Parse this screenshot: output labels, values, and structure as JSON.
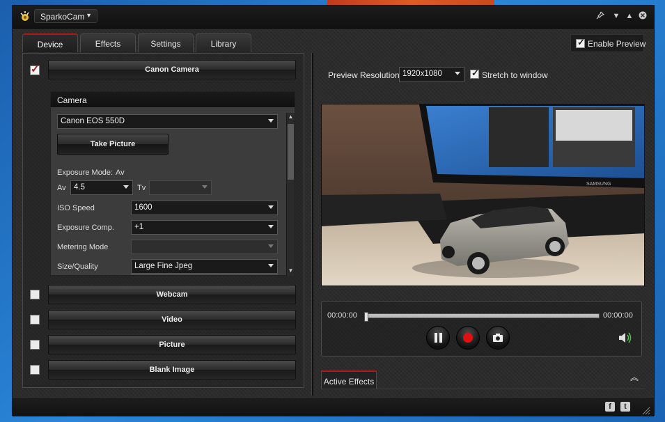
{
  "app": {
    "name": "SparkoCam"
  },
  "tabs": [
    {
      "label": "Device",
      "active": true
    },
    {
      "label": "Effects",
      "active": false
    },
    {
      "label": "Settings",
      "active": false
    },
    {
      "label": "Library",
      "active": false
    }
  ],
  "enable_preview": {
    "label": "Enable Preview",
    "checked": true
  },
  "devices": {
    "canon": {
      "label": "Canon Camera",
      "checked": true
    },
    "webcam": {
      "label": "Webcam",
      "checked": false
    },
    "video": {
      "label": "Video",
      "checked": false
    },
    "picture": {
      "label": "Picture",
      "checked": false
    },
    "blank": {
      "label": "Blank Image",
      "checked": false
    }
  },
  "camera": {
    "group_title": "Camera",
    "model": "Canon EOS 550D",
    "take_picture": "Take Picture",
    "exposure_mode_label": "Exposure Mode:",
    "exposure_mode_value": "Av",
    "av_label": "Av",
    "av_value": "4.5",
    "tv_label": "Tv",
    "tv_value": "",
    "iso_label": "ISO Speed",
    "iso_value": "1600",
    "exp_comp_label": "Exposure Comp.",
    "exp_comp_value": "+1",
    "metering_label": "Metering Mode",
    "metering_value": "",
    "size_label": "Size/Quality",
    "size_value": "Large Fine Jpeg"
  },
  "preview": {
    "resolution_label": "Preview Resolution:",
    "resolution_value": "1920x1080",
    "stretch_label": "Stretch to window",
    "stretch_checked": true,
    "monitor_brand": "SAMSUNG"
  },
  "playback": {
    "time_start": "00:00:00",
    "time_end": "00:00:00",
    "progress": 0
  },
  "active_effects": {
    "label": "Active Effects"
  },
  "colors": {
    "accent": "#b01818",
    "record": "#e01010",
    "volume": "#4cc04c"
  }
}
